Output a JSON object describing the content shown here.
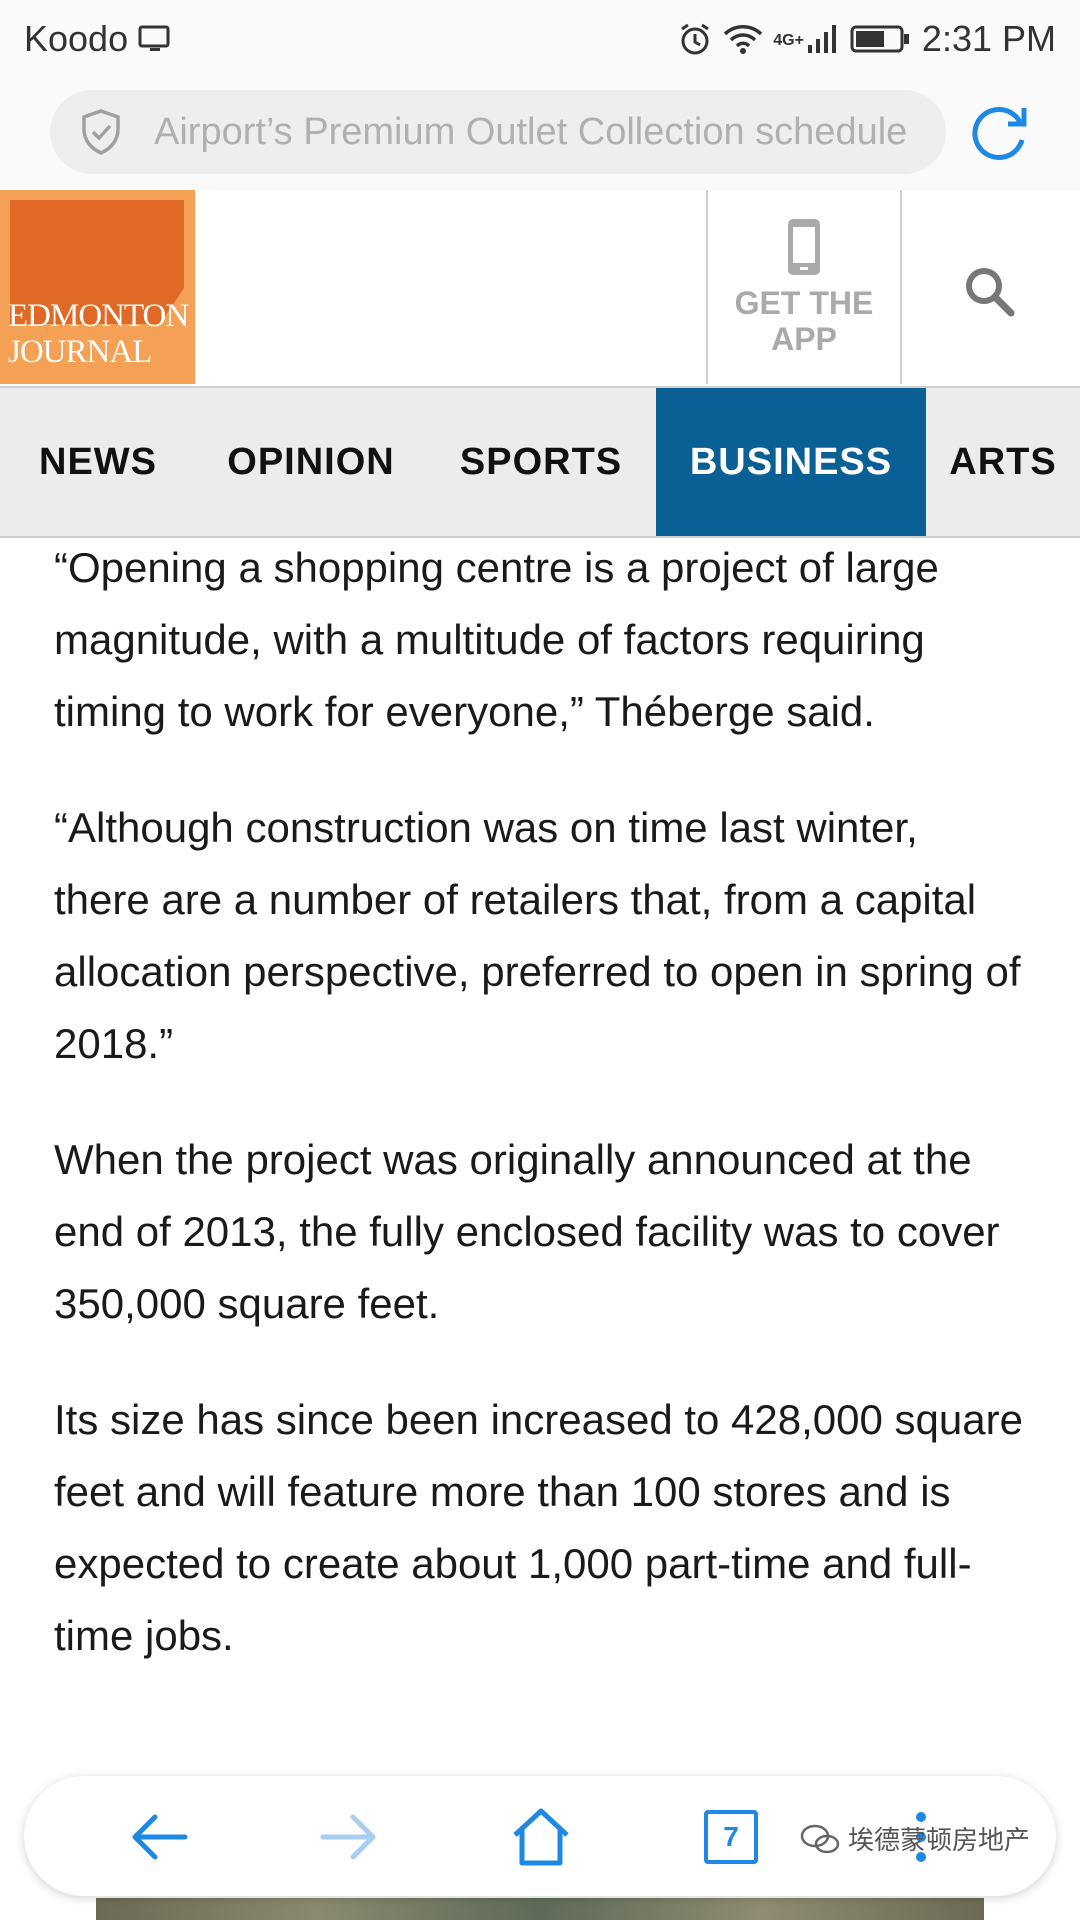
{
  "status_bar": {
    "carrier": "Koodo",
    "network": "4G+",
    "time": "2:31 PM"
  },
  "browser": {
    "url_text": "Airport’s Premium Outlet Collection schedule",
    "tab_count": "7"
  },
  "header": {
    "logo_line1": "EDMONTON",
    "logo_line2": "JOURNAL",
    "get_app_label": "GET THE APP"
  },
  "nav": {
    "items": [
      {
        "label": "NEWS"
      },
      {
        "label": "OPINION"
      },
      {
        "label": "SPORTS"
      },
      {
        "label": "BUSINESS"
      },
      {
        "label": "ARTS"
      }
    ],
    "active": "BUSINESS"
  },
  "article": {
    "paragraphs": [
      "“Opening a shopping centre is a project of large magnitude, with a multitude of factors requiring timing to work for everyone,” Théberge said.",
      "“Although construction was on time last winter, there are a number of retailers that, from a capital allocation perspective, preferred to open in spring of 2018.”",
      "When the project was originally announced at the end of 2013, the fully enclosed facility was to cover 350,000 square feet.",
      "Its size has since been increased to 428,000 square feet and will feature more than 100 stores and is expected to create about 1,000 part-time and full-time jobs."
    ]
  },
  "watermark": "埃德蒙顿房地产",
  "colors": {
    "nav_active": "#0a5f95",
    "logo_orange": "#e06a25",
    "accent_blue": "#1e88e5"
  }
}
